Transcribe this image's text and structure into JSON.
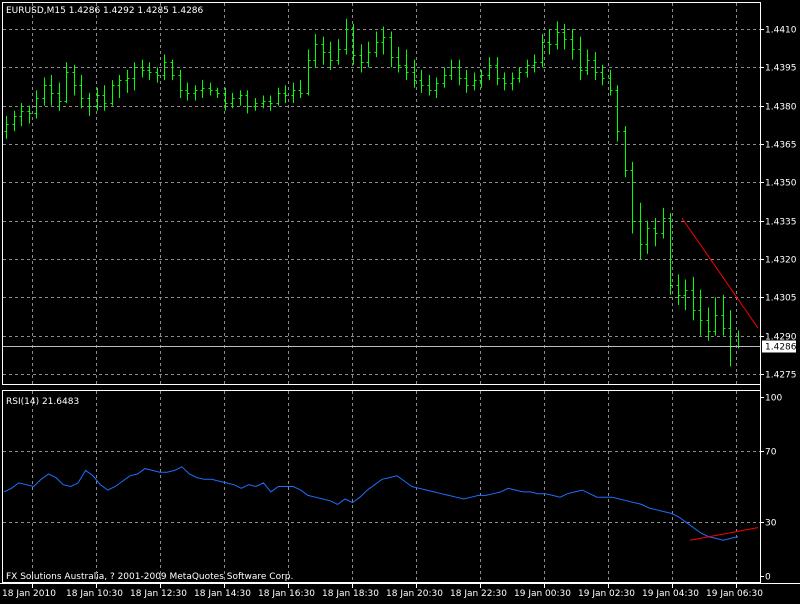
{
  "header": {
    "symbol_line": "EURUSD,M15  1.4286 1.4292 1.4285 1.4286",
    "rsi_label": "RSI(14) 21.6483",
    "copyright": "FX Solutions Australia, ? 2001-2009 MetaQuotes Software Corp."
  },
  "colors": {
    "background": "#000000",
    "bars": "#00ff00",
    "rsi_line": "#1e6fff",
    "trendline": "#ff0000",
    "grid": "#8a8a8a",
    "text": "#ffffff"
  },
  "chart_data": [
    {
      "type": "ohlc",
      "title": "EURUSD,M15",
      "ylim": [
        1.427,
        1.442
      ],
      "y_ticks": [
        "1.4410",
        "1.4395",
        "1.4380",
        "1.4365",
        "1.4350",
        "1.4335",
        "1.4320",
        "1.4305",
        "1.4290",
        "1.4275"
      ],
      "current_price_label": "1.4286",
      "x_ticks": [
        "18 Jan 2010",
        "18 Jan 10:30",
        "18 Jan 12:30",
        "18 Jan 14:30",
        "18 Jan 16:30",
        "18 Jan 18:30",
        "18 Jan 20:30",
        "18 Jan 22:30",
        "19 Jan 00:30",
        "19 Jan 02:30",
        "19 Jan 04:30",
        "19 Jan 06:30"
      ],
      "grid": true,
      "bars": [
        [
          1.437,
          1.4376,
          1.4367,
          1.4373
        ],
        [
          1.4373,
          1.4378,
          1.437,
          1.4376
        ],
        [
          1.4376,
          1.4381,
          1.4372,
          1.4378
        ],
        [
          1.4378,
          1.438,
          1.4373,
          1.4377
        ],
        [
          1.4377,
          1.4386,
          1.4375,
          1.4383
        ],
        [
          1.4383,
          1.4391,
          1.438,
          1.4388
        ],
        [
          1.4388,
          1.4392,
          1.438,
          1.4385
        ],
        [
          1.4385,
          1.4389,
          1.4378,
          1.4382
        ],
        [
          1.4382,
          1.4397,
          1.4381,
          1.4393
        ],
        [
          1.4393,
          1.4396,
          1.4384,
          1.4388
        ],
        [
          1.4388,
          1.4392,
          1.4379,
          1.4383
        ],
        [
          1.4383,
          1.4385,
          1.4376,
          1.438
        ],
        [
          1.438,
          1.4387,
          1.4378,
          1.4384
        ],
        [
          1.4384,
          1.4388,
          1.4378,
          1.4381
        ],
        [
          1.4381,
          1.439,
          1.438,
          1.4388
        ],
        [
          1.4388,
          1.4392,
          1.4383,
          1.439
        ],
        [
          1.439,
          1.4394,
          1.4385,
          1.4391
        ],
        [
          1.4391,
          1.4397,
          1.4386,
          1.4395
        ],
        [
          1.4395,
          1.4398,
          1.4391,
          1.4394
        ],
        [
          1.4394,
          1.4397,
          1.439,
          1.4393
        ],
        [
          1.4393,
          1.4395,
          1.4389,
          1.4392
        ],
        [
          1.4392,
          1.44,
          1.439,
          1.4397
        ],
        [
          1.4397,
          1.4398,
          1.439,
          1.4392
        ],
        [
          1.4392,
          1.4394,
          1.4383,
          1.4386
        ],
        [
          1.4386,
          1.4389,
          1.4382,
          1.4385
        ],
        [
          1.4385,
          1.4388,
          1.4382,
          1.4386
        ],
        [
          1.4386,
          1.439,
          1.4383,
          1.4387
        ],
        [
          1.4387,
          1.4389,
          1.4384,
          1.4386
        ],
        [
          1.4386,
          1.4387,
          1.4383,
          1.4385
        ],
        [
          1.4385,
          1.4387,
          1.4378,
          1.4381
        ],
        [
          1.4381,
          1.4385,
          1.4379,
          1.4383
        ],
        [
          1.4383,
          1.4386,
          1.438,
          1.4384
        ],
        [
          1.4384,
          1.4386,
          1.4377,
          1.438
        ],
        [
          1.438,
          1.4383,
          1.4378,
          1.4381
        ],
        [
          1.4381,
          1.4384,
          1.4379,
          1.4382
        ],
        [
          1.4382,
          1.4384,
          1.4378,
          1.4381
        ],
        [
          1.4381,
          1.4387,
          1.438,
          1.4385
        ],
        [
          1.4385,
          1.4388,
          1.4381,
          1.4384
        ],
        [
          1.4384,
          1.4389,
          1.4381,
          1.4386
        ],
        [
          1.4386,
          1.439,
          1.4383,
          1.4385
        ],
        [
          1.4385,
          1.4402,
          1.4384,
          1.4398
        ],
        [
          1.4398,
          1.4408,
          1.4395,
          1.4404
        ],
        [
          1.4404,
          1.4407,
          1.4396,
          1.4401
        ],
        [
          1.4401,
          1.4405,
          1.4394,
          1.4398
        ],
        [
          1.4398,
          1.4406,
          1.4396,
          1.4402
        ],
        [
          1.4402,
          1.4414,
          1.44,
          1.441
        ],
        [
          1.441,
          1.4412,
          1.4396,
          1.44
        ],
        [
          1.44,
          1.4404,
          1.4393,
          1.4397
        ],
        [
          1.4397,
          1.4405,
          1.4395,
          1.4401
        ],
        [
          1.4401,
          1.4409,
          1.4399,
          1.4405
        ],
        [
          1.4405,
          1.4411,
          1.44,
          1.4407
        ],
        [
          1.4407,
          1.4409,
          1.4395,
          1.4399
        ],
        [
          1.4399,
          1.4403,
          1.4393,
          1.4396
        ],
        [
          1.4396,
          1.4402,
          1.439,
          1.4393
        ],
        [
          1.4393,
          1.4398,
          1.4387,
          1.439
        ],
        [
          1.439,
          1.4394,
          1.4385,
          1.4388
        ],
        [
          1.4388,
          1.4392,
          1.4384,
          1.4386
        ],
        [
          1.4386,
          1.4391,
          1.4383,
          1.4389
        ],
        [
          1.4389,
          1.4395,
          1.4387,
          1.4392
        ],
        [
          1.4392,
          1.4398,
          1.439,
          1.4395
        ],
        [
          1.4395,
          1.4398,
          1.4388,
          1.4391
        ],
        [
          1.4391,
          1.4394,
          1.4385,
          1.4388
        ],
        [
          1.4388,
          1.4393,
          1.4386,
          1.439
        ],
        [
          1.439,
          1.4394,
          1.4387,
          1.4392
        ],
        [
          1.4392,
          1.4399,
          1.439,
          1.4396
        ],
        [
          1.4396,
          1.4399,
          1.4388,
          1.4391
        ],
        [
          1.4391,
          1.4393,
          1.4386,
          1.4389
        ],
        [
          1.4389,
          1.4393,
          1.4386,
          1.4391
        ],
        [
          1.4391,
          1.4395,
          1.4389,
          1.4393
        ],
        [
          1.4393,
          1.4398,
          1.4391,
          1.4396
        ],
        [
          1.4396,
          1.44,
          1.4393,
          1.4397
        ],
        [
          1.4397,
          1.4408,
          1.4395,
          1.4405
        ],
        [
          1.4405,
          1.441,
          1.44,
          1.4404
        ],
        [
          1.4404,
          1.4413,
          1.4402,
          1.4409
        ],
        [
          1.4409,
          1.4412,
          1.4402,
          1.4406
        ],
        [
          1.4406,
          1.441,
          1.4398,
          1.4402
        ],
        [
          1.4402,
          1.4407,
          1.439,
          1.4394
        ],
        [
          1.4394,
          1.4402,
          1.4392,
          1.4398
        ],
        [
          1.4398,
          1.4401,
          1.439,
          1.4393
        ],
        [
          1.4393,
          1.4396,
          1.4388,
          1.4391
        ],
        [
          1.4391,
          1.4394,
          1.4384,
          1.4386
        ],
        [
          1.4386,
          1.4388,
          1.4366,
          1.437
        ],
        [
          1.437,
          1.4372,
          1.4352,
          1.4355
        ],
        [
          1.4355,
          1.4358,
          1.433,
          1.4335
        ],
        [
          1.4335,
          1.4342,
          1.432,
          1.4326
        ],
        [
          1.4326,
          1.4335,
          1.4322,
          1.4332
        ],
        [
          1.4332,
          1.4336,
          1.4325,
          1.433
        ],
        [
          1.433,
          1.434,
          1.4328,
          1.4336
        ],
        [
          1.4336,
          1.4338,
          1.4306,
          1.431
        ],
        [
          1.431,
          1.4314,
          1.4302,
          1.4306
        ],
        [
          1.4306,
          1.4312,
          1.43,
          1.4308
        ],
        [
          1.4308,
          1.4313,
          1.4296,
          1.43
        ],
        [
          1.43,
          1.4308,
          1.429,
          1.4296
        ],
        [
          1.4296,
          1.4301,
          1.4288,
          1.4292
        ],
        [
          1.4292,
          1.4305,
          1.429,
          1.4298
        ],
        [
          1.4298,
          1.4306,
          1.429,
          1.4293
        ],
        [
          1.4293,
          1.43,
          1.4278,
          1.4286
        ],
        [
          1.4286,
          1.4292,
          1.4285,
          1.4286
        ]
      ]
    },
    {
      "type": "line",
      "title": "RSI(14) 21.6483",
      "ylim": [
        0,
        100
      ],
      "y_ticks": [
        "100",
        "70",
        "30",
        "0"
      ],
      "levels": [
        70,
        30
      ],
      "series": [
        {
          "values": [
            47,
            49,
            52,
            51,
            50,
            54,
            57,
            55,
            51,
            50,
            52,
            59,
            56,
            51,
            48,
            50,
            53,
            56,
            57,
            60,
            59,
            58,
            58,
            59,
            61,
            57,
            55,
            54,
            54,
            53,
            52,
            51,
            49,
            51,
            50,
            52,
            47,
            50,
            50,
            50,
            48,
            45,
            44,
            43,
            42,
            40,
            43,
            41,
            44,
            48,
            51,
            54,
            55,
            56,
            53,
            50,
            49,
            48,
            47,
            46,
            45,
            44,
            43,
            44,
            45,
            45,
            46,
            47,
            49,
            48,
            47,
            47,
            46,
            46,
            45,
            44,
            46,
            47,
            48,
            46,
            44,
            44,
            44,
            43,
            42,
            41,
            40,
            38,
            37,
            36,
            35,
            33,
            30,
            27,
            24,
            22,
            21,
            20,
            21,
            22
          ]
        }
      ]
    }
  ]
}
